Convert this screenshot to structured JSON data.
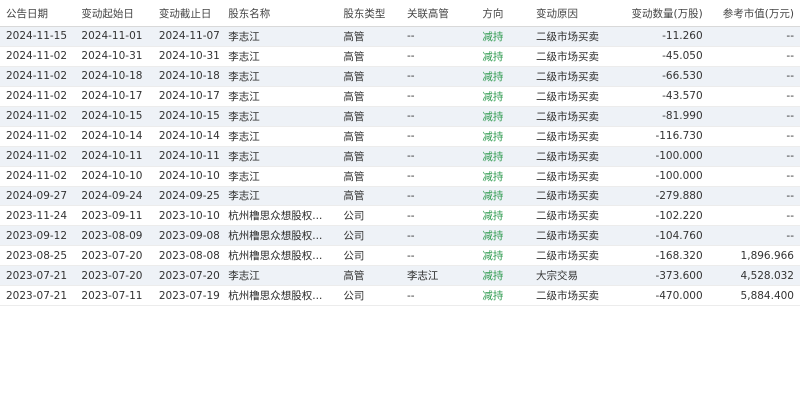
{
  "table": {
    "columns": [
      "公告日期",
      "变动起始日",
      "变动截止日",
      "股东名称",
      "股东类型",
      "关联高管",
      "方向",
      "变动原因",
      "变动数量(万股)",
      "参考市值(万元)"
    ],
    "rows": [
      [
        "2024-11-15",
        "2024-11-01",
        "2024-11-07",
        "李志江",
        "高管",
        "--",
        "减持",
        "二级市场买卖",
        "-11.260",
        "--"
      ],
      [
        "2024-11-02",
        "2024-10-31",
        "2024-10-31",
        "李志江",
        "高管",
        "--",
        "减持",
        "二级市场买卖",
        "-45.050",
        "--"
      ],
      [
        "2024-11-02",
        "2024-10-18",
        "2024-10-18",
        "李志江",
        "高管",
        "--",
        "减持",
        "二级市场买卖",
        "-66.530",
        "--"
      ],
      [
        "2024-11-02",
        "2024-10-17",
        "2024-10-17",
        "李志江",
        "高管",
        "--",
        "减持",
        "二级市场买卖",
        "-43.570",
        "--"
      ],
      [
        "2024-11-02",
        "2024-10-15",
        "2024-10-15",
        "李志江",
        "高管",
        "--",
        "减持",
        "二级市场买卖",
        "-81.990",
        "--"
      ],
      [
        "2024-11-02",
        "2024-10-14",
        "2024-10-14",
        "李志江",
        "高管",
        "--",
        "减持",
        "二级市场买卖",
        "-116.730",
        "--"
      ],
      [
        "2024-11-02",
        "2024-10-11",
        "2024-10-11",
        "李志江",
        "高管",
        "--",
        "减持",
        "二级市场买卖",
        "-100.000",
        "--"
      ],
      [
        "2024-11-02",
        "2024-10-10",
        "2024-10-10",
        "李志江",
        "高管",
        "--",
        "减持",
        "二级市场买卖",
        "-100.000",
        "--"
      ],
      [
        "2024-09-27",
        "2024-09-24",
        "2024-09-25",
        "李志江",
        "高管",
        "--",
        "减持",
        "二级市场买卖",
        "-279.880",
        "--"
      ],
      [
        "2023-11-24",
        "2023-09-11",
        "2023-10-10",
        "杭州橹思众想股权...",
        "公司",
        "--",
        "减持",
        "二级市场买卖",
        "-102.220",
        "--"
      ],
      [
        "2023-09-12",
        "2023-08-09",
        "2023-09-08",
        "杭州橹思众想股权...",
        "公司",
        "--",
        "减持",
        "二级市场买卖",
        "-104.760",
        "--"
      ],
      [
        "2023-08-25",
        "2023-07-20",
        "2023-08-08",
        "杭州橹思众想股权...",
        "公司",
        "--",
        "减持",
        "二级市场买卖",
        "-168.320",
        "1,896.966"
      ],
      [
        "2023-07-21",
        "2023-07-20",
        "2023-07-20",
        "李志江",
        "高管",
        "李志江",
        "减持",
        "大宗交易",
        "-373.600",
        "4,528.032"
      ],
      [
        "2023-07-21",
        "2023-07-11",
        "2023-07-19",
        "杭州橹思众想股权...",
        "公司",
        "--",
        "减持",
        "二级市场买卖",
        "-470.000",
        "5,884.400"
      ]
    ]
  }
}
